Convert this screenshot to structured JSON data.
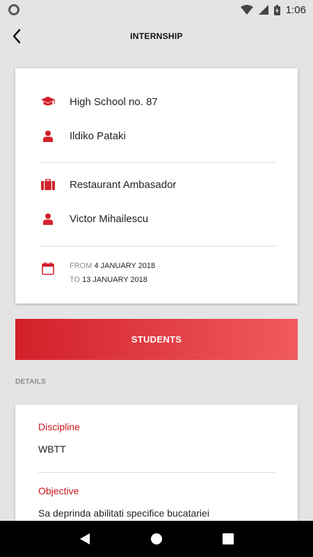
{
  "status_bar": {
    "time": "1:06"
  },
  "app_bar": {
    "title": "INTERNSHIP"
  },
  "summary": {
    "school": "High School no. 87",
    "school_contact": "Ildiko Pataki",
    "company": "Restaurant Ambasador",
    "company_contact": "Victor Mihailescu",
    "from_label": "FROM",
    "from_date": "4 JANUARY 2018",
    "to_label": "TO",
    "to_date": "13 JANUARY 2018"
  },
  "students_button": {
    "label": "STUDENTS"
  },
  "details": {
    "section_label": "DETAILS",
    "discipline_label": "Discipline",
    "discipline_value": "WBTT",
    "objective_label": "Objective",
    "objective_value": "Sa deprinda abilitati specifice bucatariei"
  },
  "colors": {
    "accent": "#d2202a",
    "accent_light": "#f05a5f"
  },
  "icons": [
    "back-arrow-icon",
    "graduation-cap-icon",
    "person-icon",
    "briefcase-icon",
    "calendar-icon"
  ]
}
